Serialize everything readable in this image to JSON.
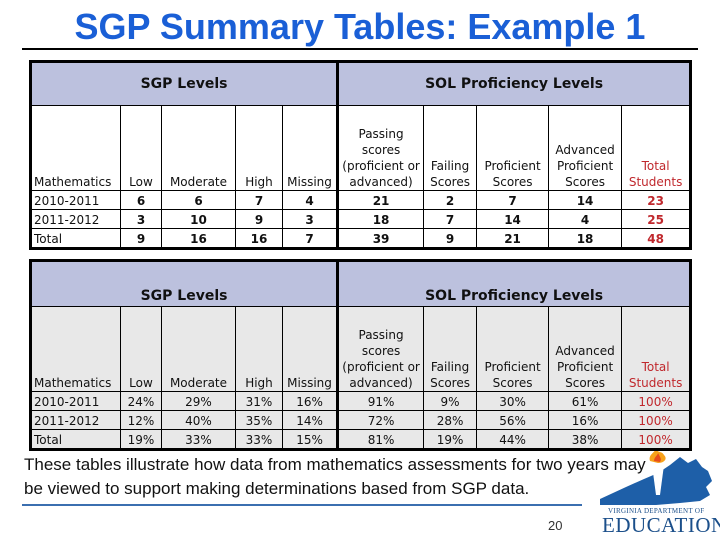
{
  "title": "SGP Summary Tables: Example 1",
  "tables": [
    {
      "band": {
        "left": "SGP Levels",
        "right": "SOL Proficiency Levels"
      },
      "headers": [
        "Mathematics",
        "Low",
        "Moderate",
        "High",
        "Missing",
        "Passing scores (proficient or advanced)",
        "Failing Scores",
        "Proficient Scores",
        "Advanced Proficient Scores",
        "Total Students"
      ],
      "rows": [
        [
          "2010-2011",
          "6",
          "6",
          "7",
          "4",
          "21",
          "2",
          "7",
          "14",
          "23"
        ],
        [
          "2011-2012",
          "3",
          "10",
          "9",
          "3",
          "18",
          "7",
          "14",
          "4",
          "25"
        ],
        [
          "Total",
          "9",
          "16",
          "16",
          "7",
          "39",
          "9",
          "21",
          "18",
          "48"
        ]
      ]
    },
    {
      "band": {
        "left": "SGP Levels",
        "right": "SOL Proficiency Levels"
      },
      "headers": [
        "Mathematics",
        "Low",
        "Moderate",
        "High",
        "Missing",
        "Passing scores (proficient or advanced)",
        "Failing Scores",
        "Proficient Scores",
        "Advanced Proficient Scores",
        "Total Students"
      ],
      "rows": [
        [
          "2010-2011",
          "24%",
          "29%",
          "31%",
          "16%",
          "91%",
          "9%",
          "30%",
          "61%",
          "100%"
        ],
        [
          "2011-2012",
          "12%",
          "40%",
          "35%",
          "14%",
          "72%",
          "28%",
          "56%",
          "16%",
          "100%"
        ],
        [
          "Total",
          "19%",
          "33%",
          "33%",
          "15%",
          "81%",
          "19%",
          "44%",
          "38%",
          "100%"
        ]
      ]
    }
  ],
  "caption": "These tables illustrate how data from mathematics assessments for two years may be viewed to support making determinations based from SGP data.",
  "page_number": "20",
  "logo": {
    "line1": "Virginia Department of",
    "line2": "EDUCATION",
    "icon": "virginia-torch-logo"
  },
  "colors": {
    "title": "#1a5fd6",
    "band": "#bcc1de",
    "total_students": "#c0282d",
    "table2_body": "#e8e8e8"
  }
}
